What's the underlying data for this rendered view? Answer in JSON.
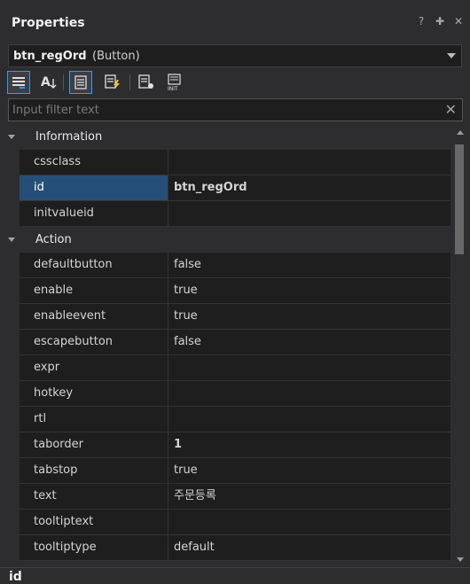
{
  "panel": {
    "title": "Properties",
    "buttons": {
      "help": "?",
      "pin": "🖈",
      "close": "✕"
    }
  },
  "object_selector": {
    "name": "btn_regOrd",
    "type": "(Button)"
  },
  "toolbar": {
    "buttons": [
      {
        "icon": "categorized-view-icon",
        "active": true
      },
      {
        "icon": "alphabetical-sort-icon",
        "active": false
      },
      {
        "icon": "properties-page-icon",
        "active": true
      },
      {
        "icon": "events-icon",
        "active": false
      },
      {
        "icon": "property-pages-icon",
        "active": false
      },
      {
        "icon": "init-value-icon",
        "active": false
      }
    ]
  },
  "filter": {
    "placeholder": "Input filter text",
    "value": "",
    "clear_icon": "✕"
  },
  "grid": {
    "categories": [
      {
        "label": "Information",
        "rows": [
          {
            "name": "cssclass",
            "value": ""
          },
          {
            "name": "id",
            "value": "btn_regOrd",
            "selected": true,
            "bold": true
          },
          {
            "name": "initvalueid",
            "value": ""
          }
        ]
      },
      {
        "label": "Action",
        "rows": [
          {
            "name": "defaultbutton",
            "value": "false"
          },
          {
            "name": "enable",
            "value": "true"
          },
          {
            "name": "enableevent",
            "value": "true"
          },
          {
            "name": "escapebutton",
            "value": "false"
          },
          {
            "name": "expr",
            "value": ""
          },
          {
            "name": "hotkey",
            "value": ""
          },
          {
            "name": "rtl",
            "value": ""
          },
          {
            "name": "taborder",
            "value": "1",
            "bold": true
          },
          {
            "name": "tabstop",
            "value": "true"
          },
          {
            "name": "text",
            "value": "주문등록"
          },
          {
            "name": "tooltiptext",
            "value": ""
          },
          {
            "name": "tooltiptype",
            "value": "default"
          }
        ]
      }
    ]
  },
  "description": {
    "title": "id"
  }
}
